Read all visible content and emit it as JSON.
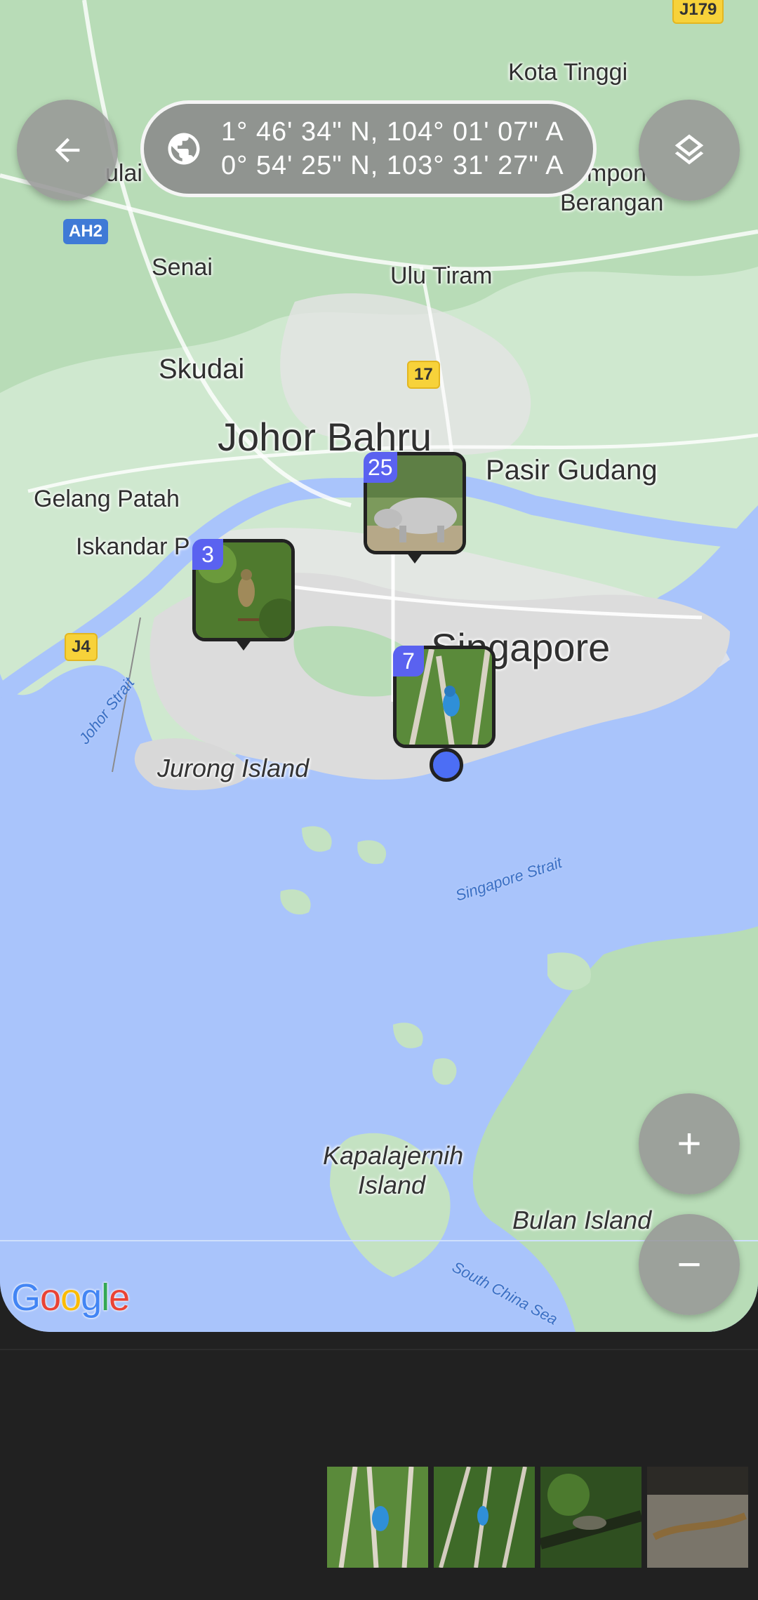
{
  "header": {
    "back_label": "back",
    "coords": {
      "line1": "1° 46' 34\" N, 104° 01' 07\" A",
      "line2": "0° 54' 25\" N, 103° 31' 27\" A"
    }
  },
  "map": {
    "places": {
      "kota_tinggi": "Kota Tinggi",
      "kulai": "ulai",
      "kampong": "mpon",
      "berangan": "Berangan",
      "senai": "Senai",
      "ulu_tiram": "Ulu Tiram",
      "skudai": "Skudai",
      "johor_bahru": "Johor Bahru",
      "pasir_gudang": "Pasir Gudang",
      "gelang_patah": "Gelang Patah",
      "iskandar": "Iskandar P",
      "singapore": "Singapore",
      "jurong_island": "Jurong Island",
      "kapalajernih": "Kapalajernih",
      "kapalajernih2": "Island",
      "bulan_island": "Bulan Island"
    },
    "water": {
      "johor_strait": "Johor Strait",
      "singapore_strait": "Singapore Strait",
      "south_china_sea": "South China Sea"
    },
    "roads": {
      "j179": "J179",
      "ah2": "AH2",
      "r17": "17",
      "j4": "J4"
    },
    "clusters": [
      {
        "count": "25",
        "subject": "rhino"
      },
      {
        "count": "3",
        "subject": "bird"
      },
      {
        "count": "7",
        "subject": "kingfisher"
      }
    ],
    "attribution": "Google"
  },
  "controls": {
    "zoom_in": "+",
    "zoom_out": "−"
  },
  "strip": {
    "thumbs": [
      "kingfisher",
      "kingfisher",
      "lizard",
      "lizard"
    ]
  },
  "colors": {
    "land": "#cfe8cf",
    "water": "#a9c4fb",
    "cluster_badge": "#5a62f0",
    "location": "#4c6ef5"
  }
}
